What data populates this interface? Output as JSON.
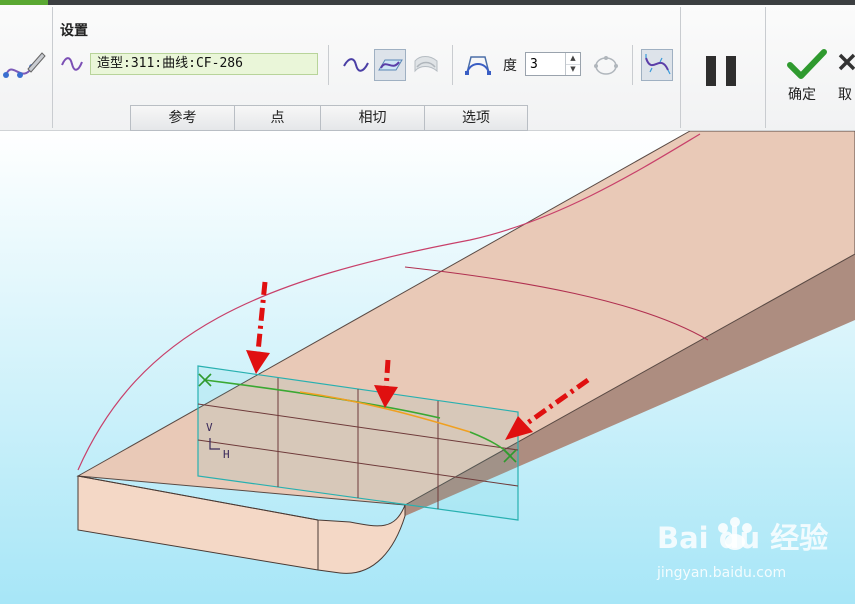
{
  "panel": {
    "title": "设置",
    "curve_ref": "造型:311:曲线:CF-286",
    "degree_label": "度",
    "degree_value": "3"
  },
  "tabs": [
    "参考",
    "点",
    "相切",
    "选项"
  ],
  "actions": {
    "ok_label": "确定",
    "cancel_label": "取"
  },
  "sketch_plane": {
    "v_label": "V",
    "h_label": "H"
  },
  "watermark": {
    "brand": "Bai du 经验",
    "url": "jingyan.baidu.com"
  },
  "colors": {
    "accent_green": "#2f9a2f",
    "curve_orange": "#f0a020",
    "arrow_red": "#e01010",
    "plane_teal": "#28b0b0",
    "body_face": "#e9c9b7"
  }
}
